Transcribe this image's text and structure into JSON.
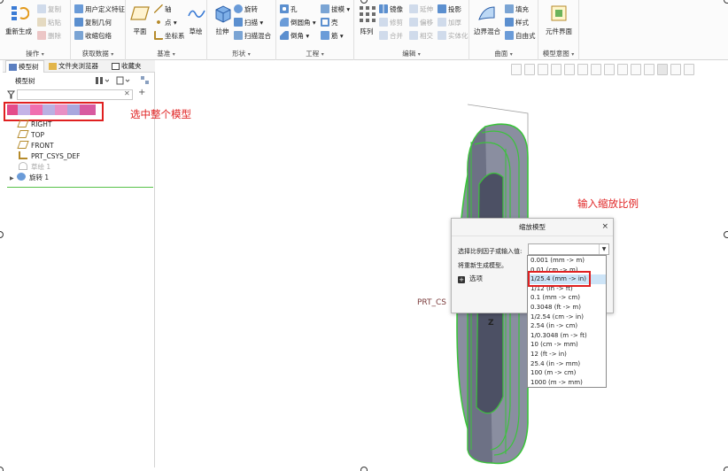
{
  "ribbon": {
    "groups": {
      "operations": "操作",
      "get_data": "获取数据",
      "datum": "基准",
      "shapes": "形状",
      "engineering": "工程",
      "editing": "编辑",
      "surfaces": "曲面",
      "model_intent": "模型意图"
    },
    "regenerate": "重新生成",
    "copy": "复制",
    "paste": "粘贴",
    "delete": "删除",
    "user_defined_feature": "用户定义特征",
    "copy_geometry": "复制几何",
    "shrinkwrap": "收缩包络",
    "plane": "平面",
    "axis": "轴",
    "point": "点",
    "csys": "坐标系",
    "sketch": "草绘",
    "extrude": "拉伸",
    "revolve": "旋转",
    "sweep": "扫描",
    "swept_blend": "扫描混合",
    "hole": "孔",
    "round": "倒圆角",
    "chamfer": "倒角",
    "draft": "拔模",
    "shell": "壳",
    "rib": "筋",
    "pattern": "阵列",
    "mirror": "镜像",
    "trim": "修剪",
    "merge": "合并",
    "extend": "延伸",
    "offset": "偏移",
    "intersect": "相交",
    "project": "投影",
    "thicken": "加厚",
    "solidify": "实体化",
    "boundary_blend": "边界混合",
    "fill": "填充",
    "style": "样式",
    "freestyle": "自由式",
    "component_interface": "元件界面"
  },
  "panel": {
    "tabs": [
      "模型树",
      "文件夹浏览器",
      "收藏夹"
    ],
    "tree_header": "模型树",
    "tree_items": [
      "RIGHT",
      "TOP",
      "FRONT",
      "PRT_CSYS_DEF",
      "草绘 1",
      "旋转 1"
    ]
  },
  "annotations": {
    "select_model": "选中整个模型",
    "enter_scale": "输入缩放比例"
  },
  "graphics": {
    "csys_label": "PRT_CS",
    "z_label": "Z"
  },
  "dialog": {
    "title": "缩放模型",
    "close": "×",
    "prompt": "选择比例因子或输入值:",
    "note": "将重新生成模型。",
    "options": "选项",
    "dropdown": [
      "0.001 (mm -> m)",
      "0.01 (cm -> m)",
      "1/25.4 (mm -> in)",
      "1/12 (in -> ft)",
      "0.1 (mm -> cm)",
      "0.3048 (ft -> m)",
      "1/2.54 (cm -> in)",
      "2.54 (in -> cm)",
      "1/0.3048 (m -> ft)",
      "10 (cm -> mm)",
      "12 (ft -> in)",
      "25.4 (in -> mm)",
      "100 (m -> cm)",
      "1000 (m -> mm)"
    ],
    "selected_index": 2
  },
  "colors": {
    "accent_red": "#e02020",
    "model_green": "#3bc33b",
    "model_body": "#8a8ea0",
    "selection_blue": "#cde4f7"
  }
}
